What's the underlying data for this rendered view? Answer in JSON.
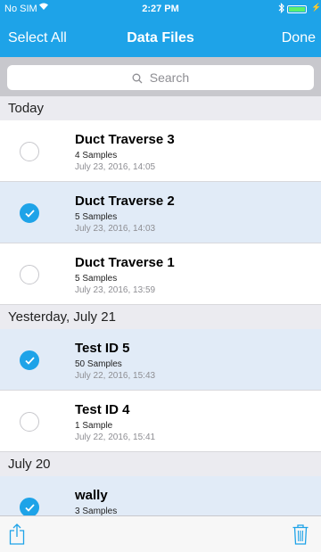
{
  "status_bar": {
    "carrier": "No SIM",
    "time": "2:27 PM"
  },
  "nav": {
    "left": "Select All",
    "title": "Data Files",
    "right": "Done"
  },
  "search": {
    "placeholder": "Search"
  },
  "sections": [
    {
      "header": "Today",
      "rows": [
        {
          "title": "Duct Traverse 3",
          "samples": "4 Samples",
          "date": "July 23, 2016, 14:05",
          "selected": false
        },
        {
          "title": "Duct Traverse 2",
          "samples": "5 Samples",
          "date": "July 23, 2016, 14:03",
          "selected": true
        },
        {
          "title": "Duct Traverse 1",
          "samples": "5 Samples",
          "date": "July 23, 2016, 13:59",
          "selected": false
        }
      ]
    },
    {
      "header": "Yesterday, July 21",
      "rows": [
        {
          "title": "Test ID 5",
          "samples": "50 Samples",
          "date": "July 22, 2016, 15:43",
          "selected": true
        },
        {
          "title": "Test ID 4",
          "samples": "1 Sample",
          "date": "July 22, 2016, 15:41",
          "selected": false
        }
      ]
    },
    {
      "header": "July 20",
      "rows": [
        {
          "title": "wally",
          "samples": "3 Samples",
          "date": "",
          "selected": true
        }
      ]
    }
  ],
  "toolbar": {
    "share_icon": "share-icon",
    "trash_icon": "trash-icon"
  },
  "colors": {
    "accent": "#1ea3e8",
    "selected_row": "#e1ebf7",
    "section_bg": "#ebebf0"
  }
}
